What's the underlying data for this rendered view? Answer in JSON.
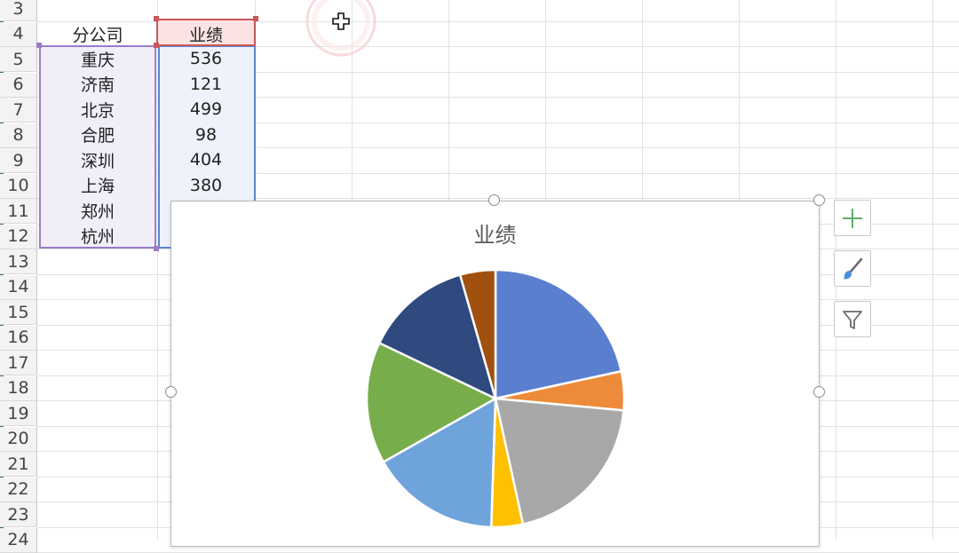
{
  "rows": [
    "3",
    "4",
    "5",
    "6",
    "7",
    "8",
    "9",
    "10",
    "11",
    "12",
    "13",
    "14",
    "15",
    "16",
    "17",
    "18",
    "19",
    "20",
    "21",
    "22",
    "23",
    "24"
  ],
  "table": {
    "header_branch": "分公司",
    "header_value": "业绩",
    "data": [
      {
        "branch": "重庆",
        "value": "536"
      },
      {
        "branch": "济南",
        "value": "121"
      },
      {
        "branch": "北京",
        "value": "499"
      },
      {
        "branch": "合肥",
        "value": "98"
      },
      {
        "branch": "深圳",
        "value": "404"
      },
      {
        "branch": "上海",
        "value": "380"
      },
      {
        "branch": "郑州",
        "value": ""
      },
      {
        "branch": "杭州",
        "value": ""
      }
    ]
  },
  "chart_data": {
    "type": "pie",
    "title": "业绩",
    "categories": [
      "重庆",
      "济南",
      "北京",
      "合肥",
      "深圳",
      "上海",
      "郑州",
      "杭州"
    ],
    "values": [
      536,
      121,
      499,
      98,
      404,
      380,
      334,
      110
    ],
    "colors": [
      "#5b7fcf",
      "#ed8b3a",
      "#a8a8a8",
      "#ffc000",
      "#6fa3dc",
      "#78ad4c",
      "#2e4a7e",
      "#a0500f"
    ]
  },
  "tools": {
    "add_icon": "plus-icon",
    "style_icon": "brush-icon",
    "filter_icon": "funnel-icon"
  }
}
